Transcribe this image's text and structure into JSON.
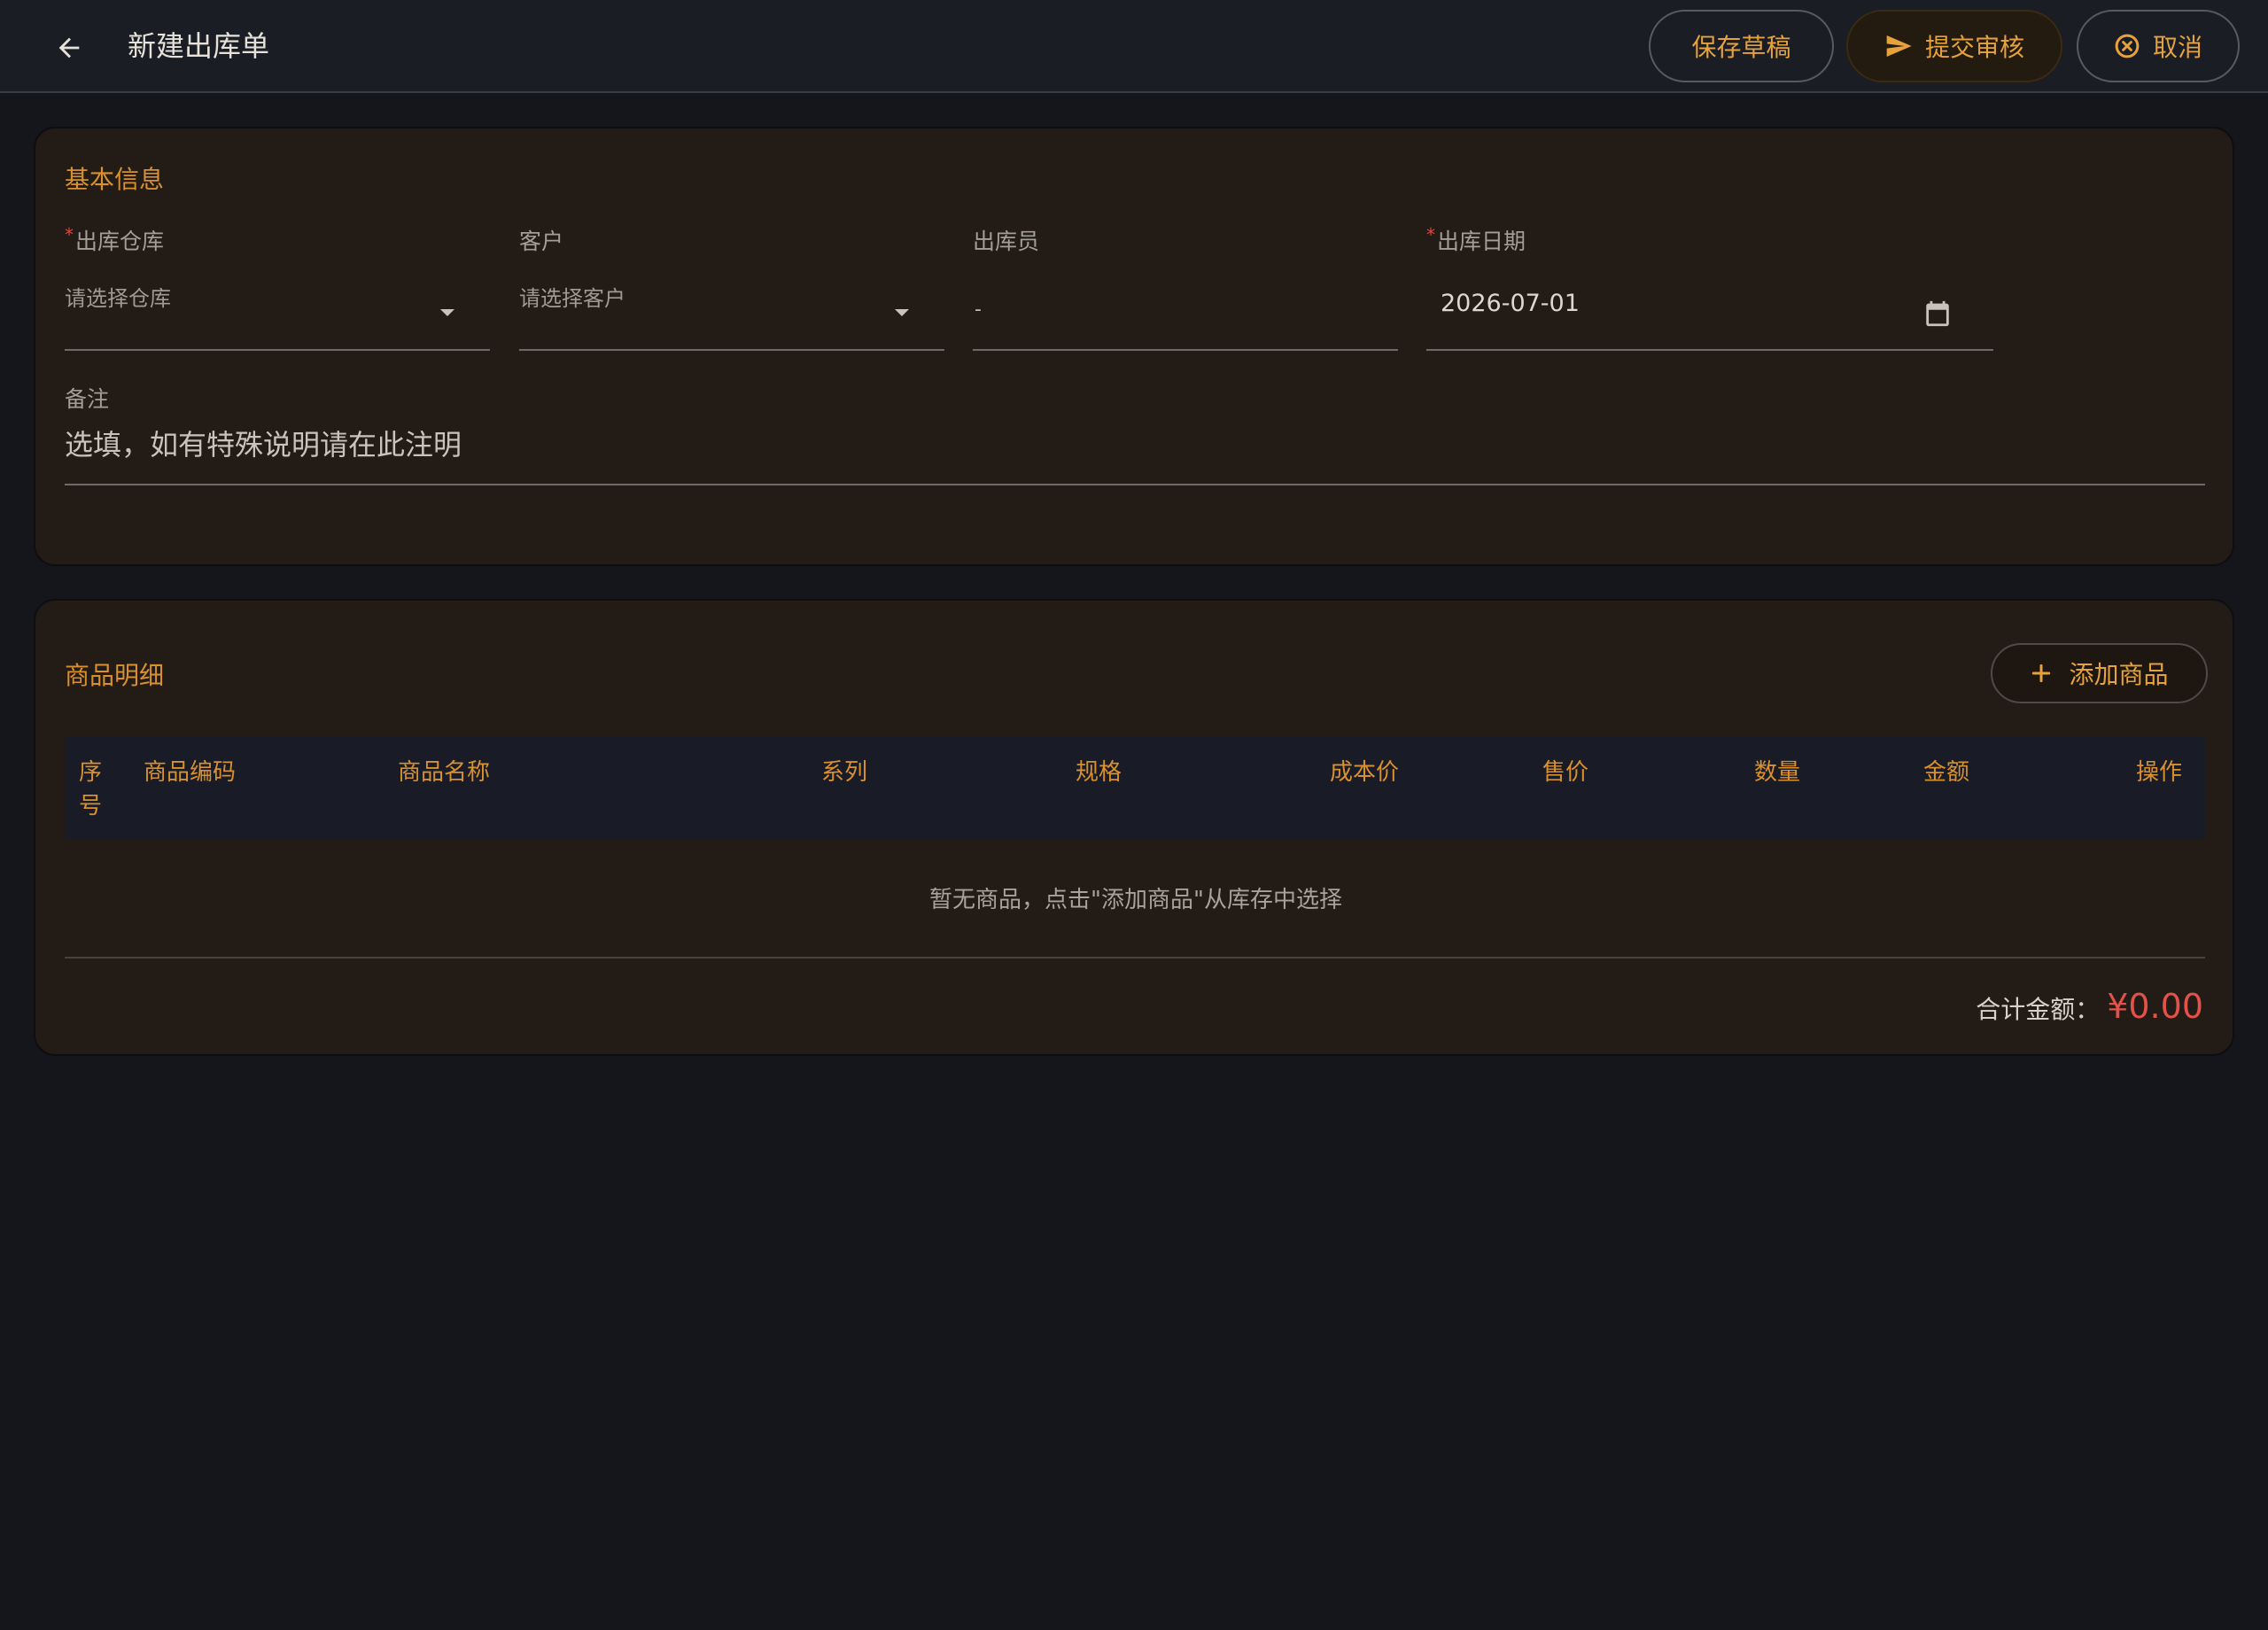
{
  "header": {
    "title": "新建出库单",
    "save_draft": "保存草稿",
    "submit_review": "提交审核",
    "cancel": "取消"
  },
  "basic_info": {
    "section_title": "基本信息",
    "warehouse": {
      "label": "出库仓库",
      "placeholder": "请选择仓库",
      "required": true
    },
    "customer": {
      "label": "客户",
      "placeholder": "请选择客户",
      "required": false
    },
    "operator": {
      "label": "出库员",
      "value": "-"
    },
    "date": {
      "label": "出库日期",
      "value": "2026-07-01",
      "required": true
    },
    "remark": {
      "label": "备注",
      "placeholder": "选填，如有特殊说明请在此注明"
    }
  },
  "items": {
    "section_title": "商品明细",
    "add_button": "添加商品",
    "columns": {
      "seq": "序号",
      "code": "商品编码",
      "name": "商品名称",
      "series": "系列",
      "spec": "规格",
      "cost": "成本价",
      "price": "售价",
      "qty": "数量",
      "amount": "金额",
      "action": "操作"
    },
    "empty_text": "暂无商品，点击\"添加商品\"从库存中选择",
    "total_label": "合计金额：",
    "total_value": "¥0.00"
  },
  "colors": {
    "accent": "#e6a23c",
    "danger": "#e0524a",
    "background": "#15161c",
    "card": "#231b15"
  }
}
